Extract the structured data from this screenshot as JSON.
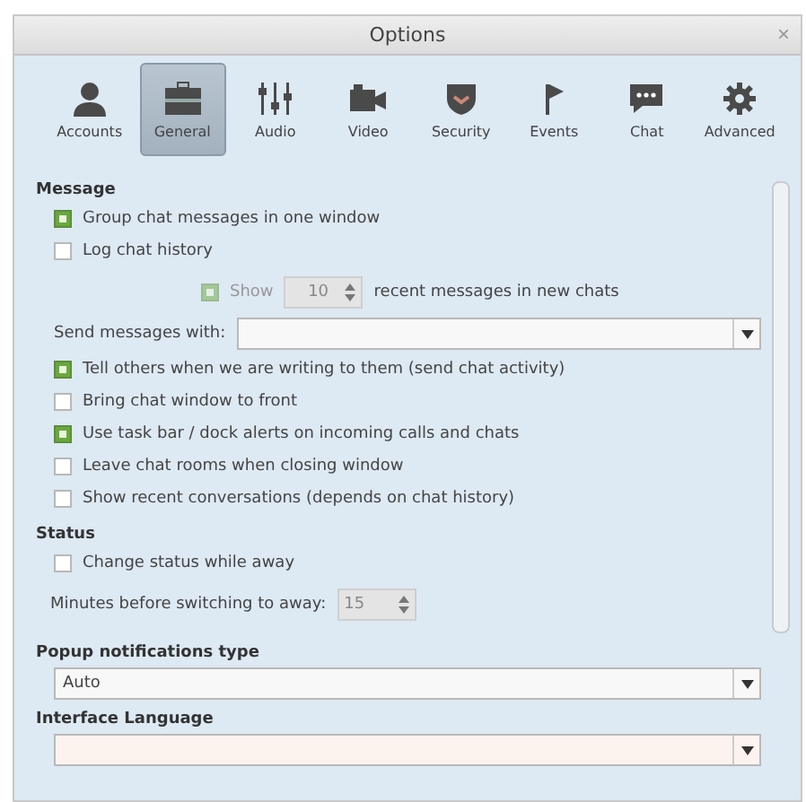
{
  "window": {
    "title": "Options",
    "close": "×"
  },
  "tabs": [
    {
      "label": "Accounts",
      "selected": false
    },
    {
      "label": "General",
      "selected": true
    },
    {
      "label": "Audio",
      "selected": false
    },
    {
      "label": "Video",
      "selected": false
    },
    {
      "label": "Security",
      "selected": false
    },
    {
      "label": "Events",
      "selected": false
    },
    {
      "label": "Chat",
      "selected": false
    },
    {
      "label": "Advanced",
      "selected": false
    }
  ],
  "message": {
    "heading": "Message",
    "options": [
      {
        "label": "Group chat messages in one window",
        "checked": true
      },
      {
        "label": "Log chat history",
        "checked": false
      }
    ],
    "history": {
      "checked": true,
      "disabled": true,
      "label": "Show",
      "count": "10",
      "suffix": "recent messages in new chats"
    },
    "send_label": "Send messages with:",
    "more_options": [
      {
        "label": "Tell others when we are writing to them (send chat activity)",
        "checked": true
      },
      {
        "label": "Bring chat window to front",
        "checked": false
      },
      {
        "label": "Use task bar / dock alerts on incoming calls and chats",
        "checked": true
      },
      {
        "label": "Leave chat rooms when closing window",
        "checked": false
      },
      {
        "label": "Show recent conversations (depends on chat history)",
        "checked": false
      }
    ]
  },
  "status": {
    "heading": "Status",
    "options": [
      {
        "label": "Change status while away",
        "checked": false
      }
    ],
    "minutes_label": "Minutes before switching to away:",
    "minutes": "15",
    "minutes_disabled": true
  },
  "popup": {
    "heading": "Popup notifications type",
    "value": "Auto"
  },
  "language": {
    "heading": "Interface Language"
  }
}
